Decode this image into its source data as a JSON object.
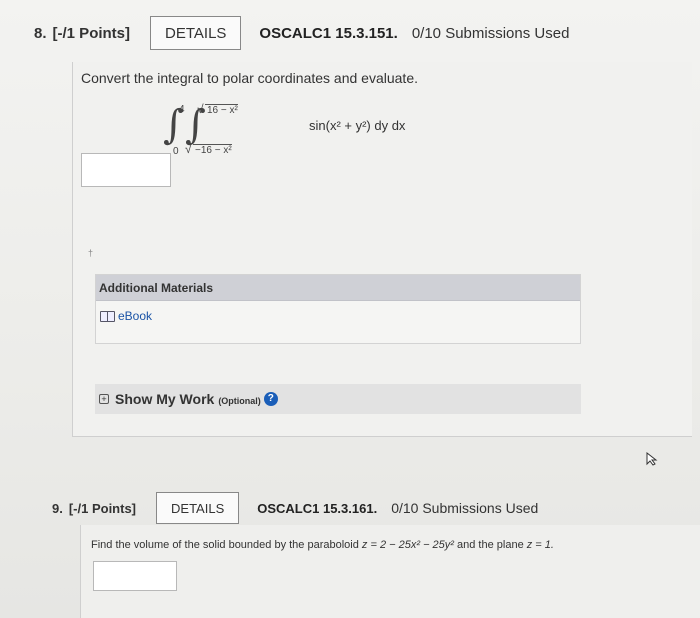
{
  "q8": {
    "number": "8.",
    "points": "[-/1 Points]",
    "details_label": "DETAILS",
    "code": "OSCALC1 15.3.151.",
    "submissions": "0/10 Submissions Used",
    "prompt": "Convert the integral to polar coordinates and evaluate.",
    "integral": {
      "outer_lower": "0",
      "outer_upper": "4",
      "inner_lower": "−16 − x²",
      "inner_upper": "16 − x²",
      "integrand": "sin(x² + y²) dy dx"
    },
    "answer_value": "",
    "mark": "†",
    "additional_materials": {
      "heading": "Additional Materials",
      "ebook_label": "eBook"
    },
    "show_my_work": {
      "label": "Show My Work",
      "optional": "(Optional)",
      "help": "?"
    }
  },
  "q9": {
    "number": "9.",
    "points": "[-/1 Points]",
    "details_label": "DETAILS",
    "code": "OSCALC1 15.3.161.",
    "submissions": "0/10 Submissions Used",
    "prompt_text": "Find the volume of the solid bounded by the paraboloid",
    "equation": "z = 2 − 25x² − 25y²",
    "prompt_mid": "and the plane",
    "plane": "z = 1.",
    "answer_value": ""
  }
}
